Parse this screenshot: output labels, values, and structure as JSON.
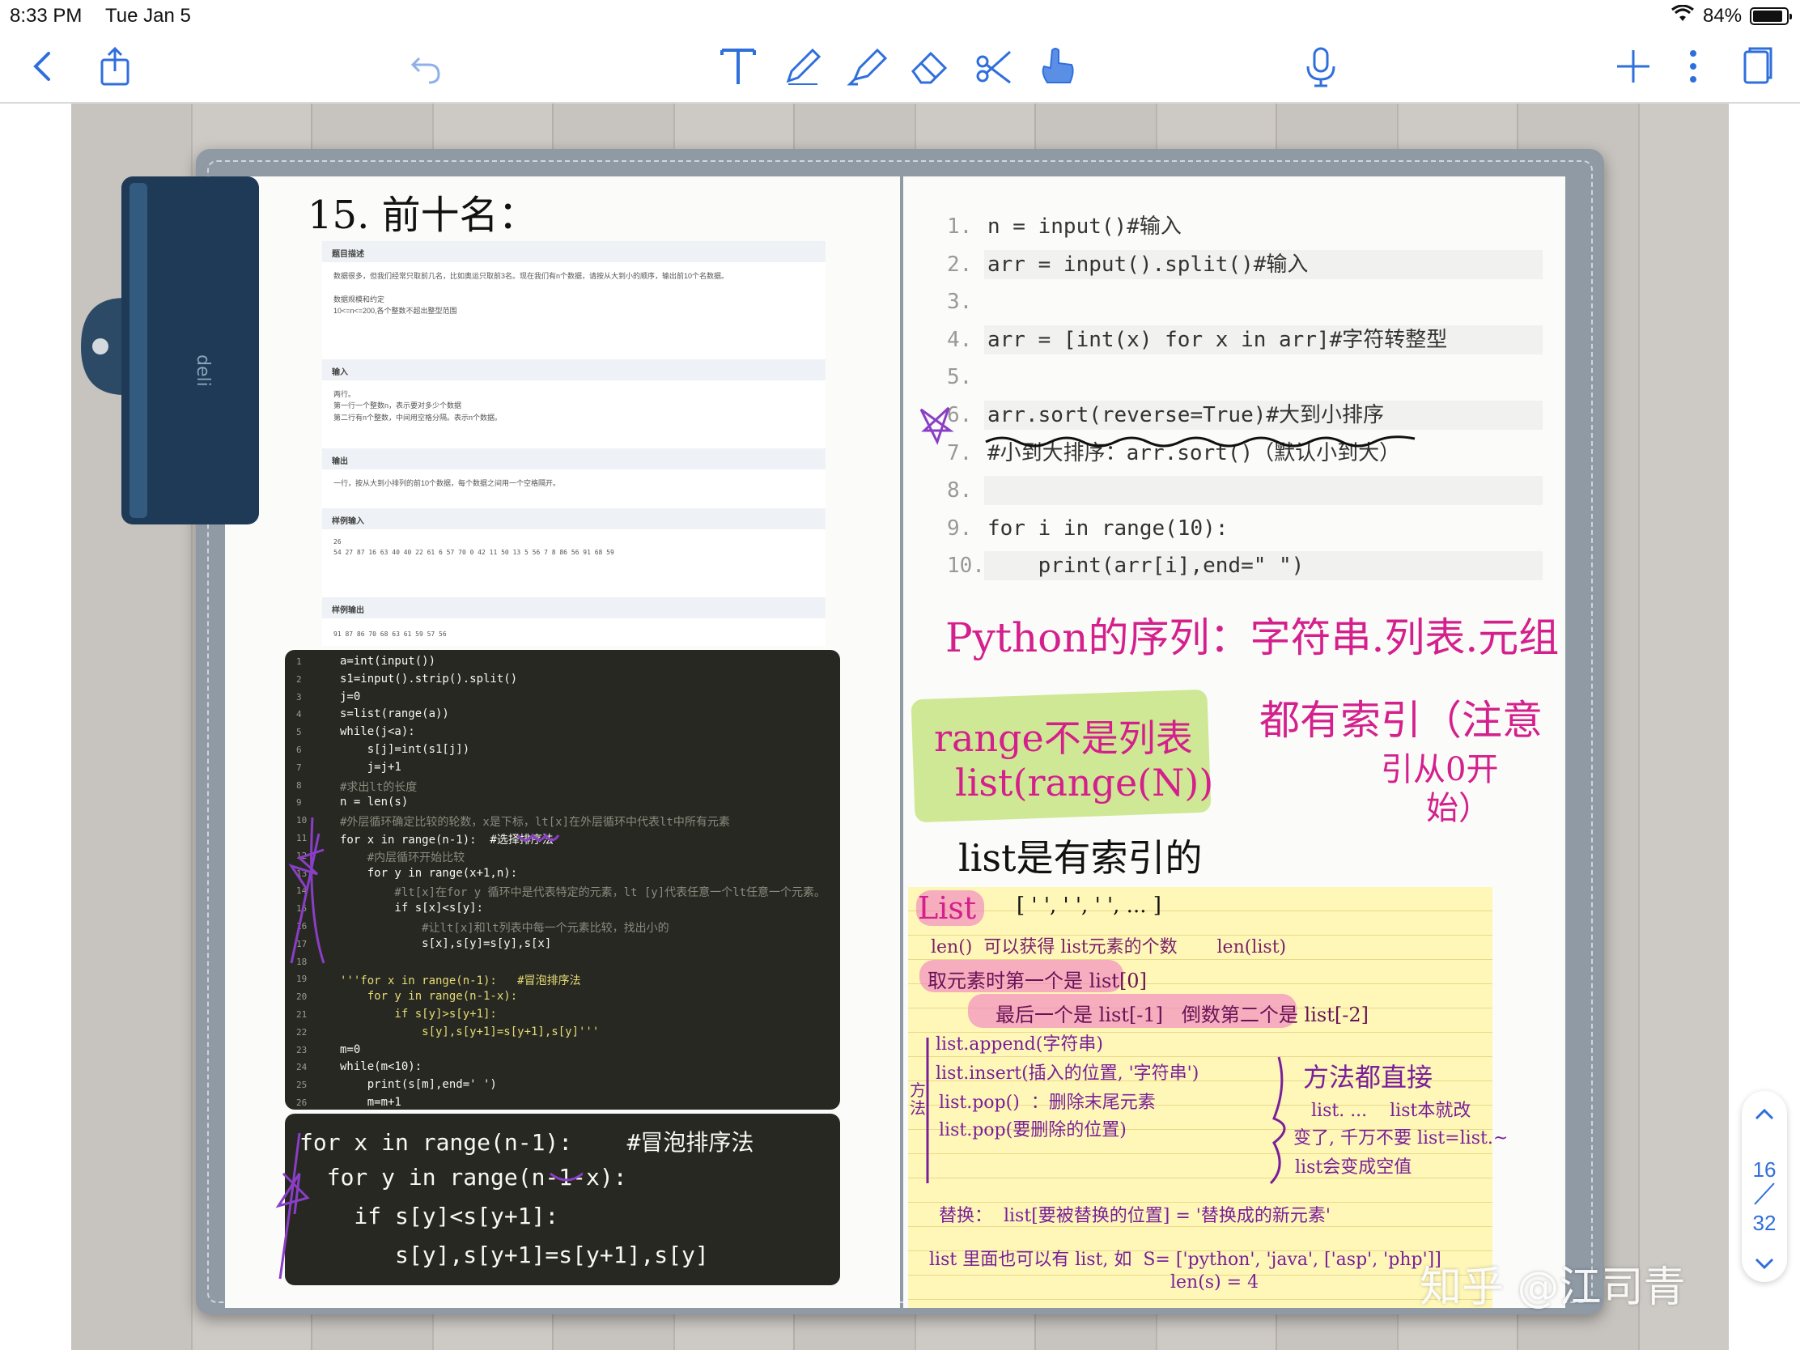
{
  "status_bar": {
    "time": "8:33 PM",
    "date": "Tue Jan 5",
    "battery": "84%"
  },
  "toolbar": {
    "back_icon": "chevron-left-icon",
    "share_icon": "share-icon",
    "undo_icon": "undo-icon",
    "tools": [
      "text-tool-icon",
      "pen-icon",
      "highlighter-icon",
      "eraser-icon",
      "lasso-scissors-icon",
      "hand-pointer-icon"
    ],
    "mic_icon": "microphone-icon",
    "add_icon": "plus-icon",
    "more_icon": "more-vertical-icon",
    "pages_icon": "pages-icon",
    "accent": "#2f6fdc"
  },
  "left_page": {
    "heading": "15. 前十名：",
    "problem": {
      "sections": [
        {
          "title": "题目描述",
          "body": "数据很多，但我们经常只取前几名，比如奥运只取前3名。现在我们有n个数据，请按从大到小的顺序，输出前10个名数据。\n\n数据规模和约定\n10<=n<=200,各个整数不超出整型范围"
        },
        {
          "title": "输入",
          "body": "两行。\n第一行一个整数n，表示要对多少个数据\n第二行有n个整数，中间用空格分隔。表示n个数据。"
        },
        {
          "title": "输出",
          "body": "一行，按从大到小排列的前10个数据，每个数据之间用一个空格隔开。"
        },
        {
          "title": "样例输入",
          "body": "26\n54 27 87 16 63 40 40 22 61 6 57 70 0 42 11 50 13 5 56 7 8 86 56 91 68 59"
        },
        {
          "title": "样例输出",
          "body": "91 87 86 70 68 63 61 59 57 56"
        }
      ]
    },
    "code_lines": [
      {
        "n": "1",
        "code": "a=int(input())",
        "kind": "code"
      },
      {
        "n": "2",
        "code": "s1=input().strip().split()",
        "kind": "code"
      },
      {
        "n": "3",
        "code": "j=0",
        "kind": "code"
      },
      {
        "n": "4",
        "code": "s=list(range(a))",
        "kind": "code"
      },
      {
        "n": "5",
        "code": "while(j<a):",
        "kind": "code"
      },
      {
        "n": "6",
        "code": "    s[j]=int(s1[j])",
        "kind": "code"
      },
      {
        "n": "7",
        "code": "    j=j+1",
        "kind": "code"
      },
      {
        "n": "8",
        "code": "#求出lt的长度",
        "kind": "comment"
      },
      {
        "n": "9",
        "code": "n = len(s)",
        "kind": "code"
      },
      {
        "n": "10",
        "code": "#外层循环确定比较的轮数，x是下标，lt[x]在外层循环中代表lt中所有元素",
        "kind": "comment"
      },
      {
        "n": "11",
        "code": "for x in range(n-1):  #选择排序法",
        "kind": "code"
      },
      {
        "n": "12",
        "code": "    #内层循环开始比较",
        "kind": "comment"
      },
      {
        "n": "13",
        "code": "    for y in range(x+1,n):",
        "kind": "code"
      },
      {
        "n": "14",
        "code": "        #lt[x]在for y 循环中是代表特定的元素，lt [y]代表任意一个lt任意一个元素。",
        "kind": "comment"
      },
      {
        "n": "15",
        "code": "        if s[x]<s[y]:",
        "kind": "code"
      },
      {
        "n": "16",
        "code": "            #让lt[x]和lt列表中每一个元素比较，找出小的",
        "kind": "comment"
      },
      {
        "n": "17",
        "code": "            s[x],s[y]=s[y],s[x]",
        "kind": "code"
      },
      {
        "n": "18",
        "code": "",
        "kind": "code"
      },
      {
        "n": "19",
        "code": "'''for x in range(n-1):   #冒泡排序法",
        "kind": "docstr"
      },
      {
        "n": "20",
        "code": "    for y in range(n-1-x):",
        "kind": "docstr"
      },
      {
        "n": "21",
        "code": "        if s[y]>s[y+1]:",
        "kind": "docstr"
      },
      {
        "n": "22",
        "code": "            s[y],s[y+1]=s[y+1],s[y]'''",
        "kind": "docstr"
      },
      {
        "n": "23",
        "code": "m=0",
        "kind": "code"
      },
      {
        "n": "24",
        "code": "while(m<10):",
        "kind": "code"
      },
      {
        "n": "25",
        "code": "    print(s[m],end=' ')",
        "kind": "code"
      },
      {
        "n": "26",
        "code": "    m=m+1",
        "kind": "code"
      }
    ],
    "big_code": [
      "for x in range(n-1):    #冒泡排序法",
      "  for y in range(n-1-x):",
      "    if s[y]<s[y+1]:",
      "       s[y],s[y+1]=s[y+1],s[y]"
    ]
  },
  "right_page": {
    "code_lines": [
      {
        "n": "1.",
        "code": "n = input()#输入"
      },
      {
        "n": "2.",
        "code": "arr = input().split()#输入"
      },
      {
        "n": "3.",
        "code": ""
      },
      {
        "n": "4.",
        "code": "arr = [int(x) for x in arr]#字符转整型"
      },
      {
        "n": "5.",
        "code": ""
      },
      {
        "n": "6.",
        "code": "arr.sort(reverse=True)#大到小排序"
      },
      {
        "n": "7.",
        "code": "#小到大排序：arr.sort()（默认小到大）"
      },
      {
        "n": "8.",
        "code": ""
      },
      {
        "n": "9.",
        "code": "for i in range(10):"
      },
      {
        "n": "10.",
        "code": "    print(arr[i],end=\" \")"
      }
    ],
    "notes": {
      "sequence": "Python的序列：字符串.列表.元组",
      "all_indexed": "都有索引（注意",
      "index_from": "引从0开",
      "index_from_2": "始）",
      "range_note_1": "range不是列表",
      "range_note_2": "list(range(N))",
      "list_indexed": "list是有索引的",
      "yellow": {
        "title": "List",
        "brackets": "[ ' ', ' ', ' ', ... ]",
        "len_note": "len()  可以获得 list元素的个数       len(list)",
        "first": "取元素时第一个是 list[0]",
        "last": "最后一个是 list[-1]   倒数第二个是 list[-2]",
        "append": "list.append(字符串)",
        "insert": "list.insert(插入的位置, '字符串')",
        "pop": "list.pop()  ：删除末尾元素",
        "pop_idx": "list.pop(要删除的位置)",
        "method": "方法",
        "direct": "方法都直接",
        "direct_2": "list. ...    list本就改",
        "direct_3": "变了, 千万不要 list=list.~",
        "direct_4": "list会变成空值",
        "replace": "替换：  list[要被替换的位置] = '替换成的新元素'",
        "nested": "list 里面也可以有 list, 如  S= ['python', 'java', ['asp', 'php']]",
        "nested_len": "len(s) = 4"
      }
    }
  },
  "page_nav": {
    "current": "16",
    "total": "32"
  },
  "watermark": "知乎 @江司青"
}
